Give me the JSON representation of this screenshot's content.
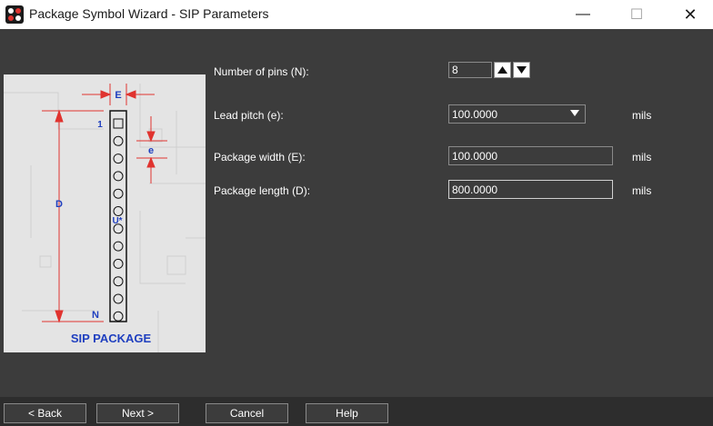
{
  "window": {
    "title": "Package Symbol Wizard - SIP Parameters",
    "controls": {
      "minimize": "—",
      "maximize": "☐",
      "close": "✕"
    }
  },
  "preview": {
    "label_E": "E",
    "label_e": "e",
    "label_D": "D",
    "label_1": "1",
    "label_N": "N",
    "label_U": "U*",
    "caption": "SIP PACKAGE"
  },
  "form": {
    "pins": {
      "label": "Number of pins (N):",
      "value": "8"
    },
    "pitch": {
      "label": "Lead pitch (e):",
      "value": "100.0000",
      "unit": "mils"
    },
    "width": {
      "label": "Package width (E):",
      "value": "100.0000",
      "unit": "mils"
    },
    "length": {
      "label": "Package length (D):",
      "value": "800.0000",
      "unit": "mils"
    }
  },
  "buttons": {
    "back": "< Back",
    "next": "Next >",
    "cancel": "Cancel",
    "help": "Help"
  },
  "colors": {
    "background": "#3c3c3c",
    "dimension_red": "#e0332f",
    "label_blue": "#1f3fbf"
  }
}
